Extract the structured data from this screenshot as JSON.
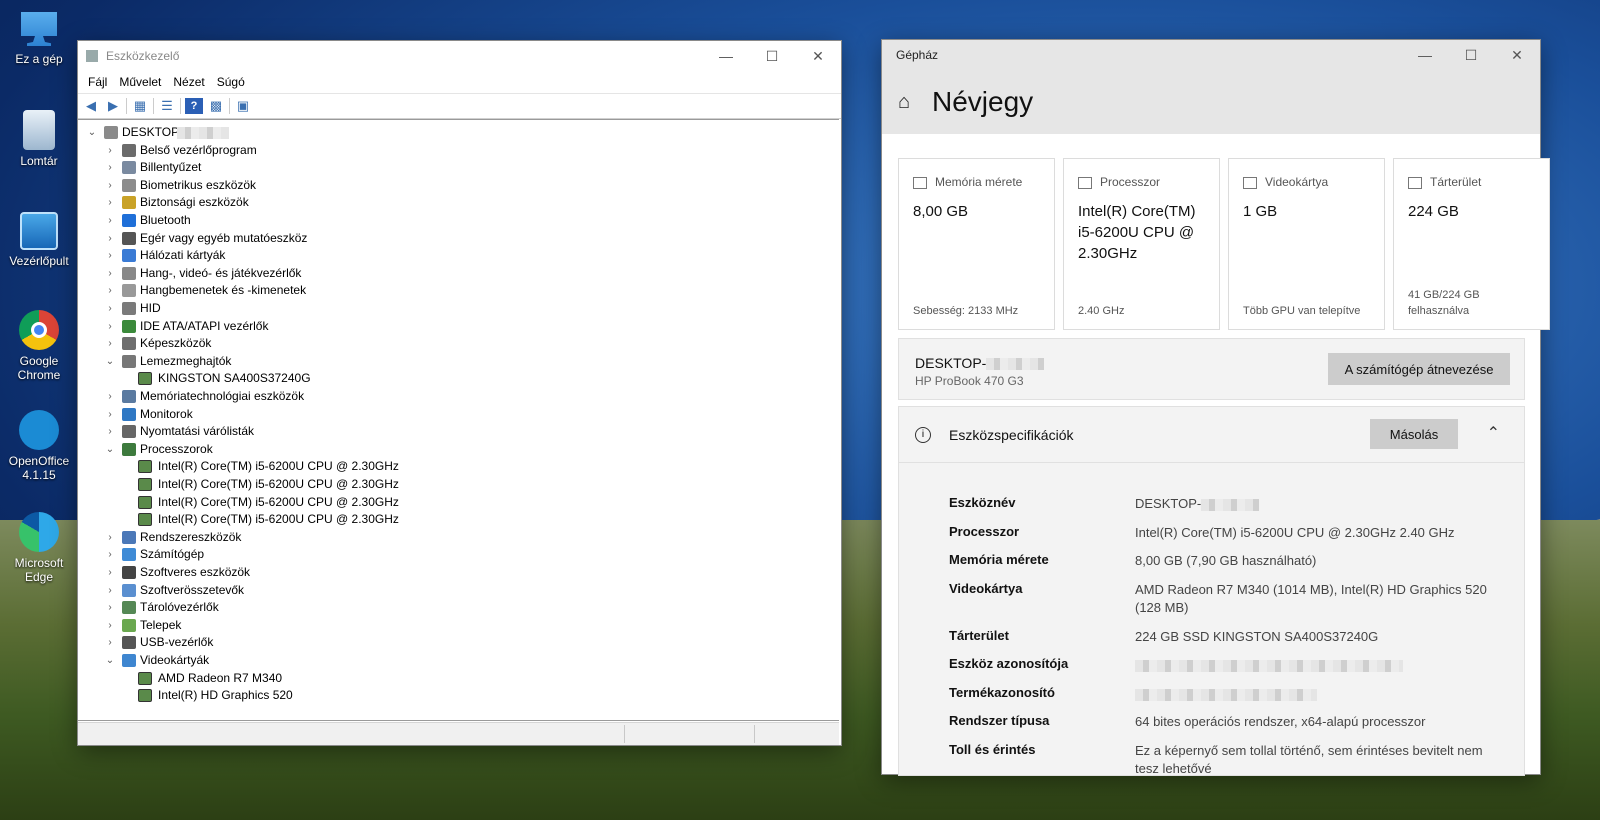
{
  "desktop": {
    "icons": [
      {
        "label": "Ez a gép",
        "icon": "computer-icon"
      },
      {
        "label": "Lomtár",
        "icon": "recycle-bin-icon"
      },
      {
        "label": "Vezérlőpult",
        "icon": "control-panel-icon"
      },
      {
        "label": "Google Chrome",
        "icon": "chrome-icon"
      },
      {
        "label": "OpenOffice 4.1.15",
        "icon": "openoffice-icon"
      },
      {
        "label": "Microsoft Edge",
        "icon": "edge-icon"
      }
    ]
  },
  "devmgr": {
    "title": "Eszközkezelő",
    "menu": [
      "Fájl",
      "Művelet",
      "Nézet",
      "Súgó"
    ],
    "root": "DESKTOP-",
    "tree": [
      {
        "label": "Belső vezérlőprogram",
        "expanded": false
      },
      {
        "label": "Billentyűzet",
        "expanded": false
      },
      {
        "label": "Biometrikus eszközök",
        "expanded": false
      },
      {
        "label": "Biztonsági eszközök",
        "expanded": false
      },
      {
        "label": "Bluetooth",
        "expanded": false
      },
      {
        "label": "Egér vagy egyéb mutatóeszköz",
        "expanded": false
      },
      {
        "label": "Hálózati kártyák",
        "expanded": false
      },
      {
        "label": "Hang-, videó- és játékvezérlők",
        "expanded": false
      },
      {
        "label": "Hangbemenetek és -kimenetek",
        "expanded": false
      },
      {
        "label": "HID",
        "expanded": false
      },
      {
        "label": "IDE ATA/ATAPI vezérlők",
        "expanded": false
      },
      {
        "label": "Képeszközök",
        "expanded": false
      },
      {
        "label": "Lemezmeghajtók",
        "expanded": true,
        "children": [
          "KINGSTON SA400S37240G"
        ]
      },
      {
        "label": "Memóriatechnológiai eszközök",
        "expanded": false
      },
      {
        "label": "Monitorok",
        "expanded": false
      },
      {
        "label": "Nyomtatási várólisták",
        "expanded": false
      },
      {
        "label": "Processzorok",
        "expanded": true,
        "children": [
          "Intel(R) Core(TM) i5-6200U CPU @ 2.30GHz",
          "Intel(R) Core(TM) i5-6200U CPU @ 2.30GHz",
          "Intel(R) Core(TM) i5-6200U CPU @ 2.30GHz",
          "Intel(R) Core(TM) i5-6200U CPU @ 2.30GHz"
        ]
      },
      {
        "label": "Rendszereszközök",
        "expanded": false
      },
      {
        "label": "Számítógép",
        "expanded": false
      },
      {
        "label": "Szoftveres eszközök",
        "expanded": false
      },
      {
        "label": "Szoftverösszetevők",
        "expanded": false
      },
      {
        "label": "Tárolóvezérlők",
        "expanded": false
      },
      {
        "label": "Telepek",
        "expanded": false
      },
      {
        "label": "USB-vezérlők",
        "expanded": false
      },
      {
        "label": "Videokártyák",
        "expanded": true,
        "children": [
          "AMD Radeon R7 M340",
          "Intel(R) HD Graphics 520"
        ]
      }
    ]
  },
  "settings": {
    "title": "Gépház",
    "page_title": "Névjegy",
    "cards": [
      {
        "label": "Memória mérete",
        "value": "8,00 GB",
        "sub": "Sebesség: 2133 MHz"
      },
      {
        "label": "Processzor",
        "value": "Intel(R) Core(TM) i5-6200U CPU @ 2.30GHz",
        "sub": "2.40 GHz"
      },
      {
        "label": "Videokártya",
        "value": "1 GB",
        "sub": "Több GPU van telepítve"
      },
      {
        "label": "Tárterület",
        "value": "224 GB",
        "sub": "41 GB/224 GB felhasználva"
      }
    ],
    "device_name": "DESKTOP-",
    "model": "HP ProBook 470 G3",
    "rename_button": "A számítógép átnevezése",
    "specs_title": "Eszközspecifikációk",
    "copy_button": "Másolás",
    "specs": [
      {
        "key": "Eszköznév",
        "value": "DESKTOP-"
      },
      {
        "key": "Processzor",
        "value": "Intel(R) Core(TM) i5-6200U CPU @ 2.30GHz   2.40 GHz"
      },
      {
        "key": "Memória mérete",
        "value": "8,00 GB (7,90 GB használható)"
      },
      {
        "key": "Videokártya",
        "value": "AMD Radeon R7 M340 (1014 MB), Intel(R) HD Graphics 520 (128 MB)"
      },
      {
        "key": "Tárterület",
        "value": "224 GB SSD KINGSTON SA400S37240G"
      },
      {
        "key": "Eszköz azonosítója",
        "value": ""
      },
      {
        "key": "Termékazonosító",
        "value": ""
      },
      {
        "key": "Rendszer típusa",
        "value": "64 bites operációs rendszer, x64-alapú processzor"
      },
      {
        "key": "Toll és érintés",
        "value": "Ez a képernyő sem tollal történő, sem érintéses bevitelt nem tesz lehetővé"
      }
    ]
  }
}
